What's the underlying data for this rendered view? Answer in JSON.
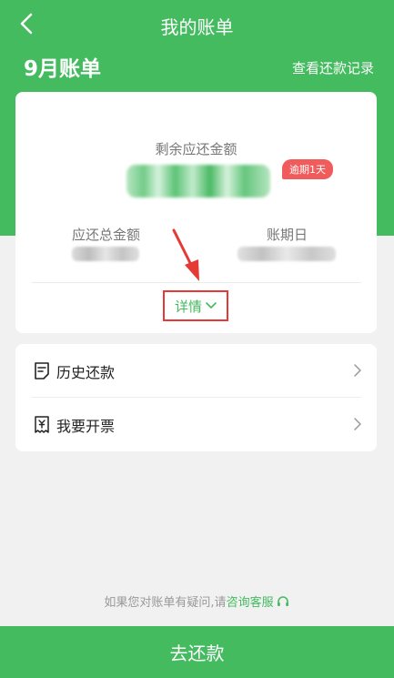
{
  "colors": {
    "brand_green": "#44bb5f",
    "overdue_red": "#f05b5b",
    "highlight_red": "#e53935"
  },
  "nav": {
    "title": "我的账单",
    "back_icon": "chevron-left-icon"
  },
  "header": {
    "month_title": "9月账单",
    "records_link": "查看还款记录"
  },
  "bill": {
    "remaining_label": "剩余应还金额",
    "overdue_badge": "逾期1天",
    "total_label": "应还总金额",
    "date_label": "账期日",
    "detail_label": "详情"
  },
  "menu": [
    {
      "label": "历史还款",
      "icon": "receipt-list-icon"
    },
    {
      "label": "我要开票",
      "icon": "invoice-icon"
    }
  ],
  "help": {
    "prefix": "如果您对账单有疑问,请",
    "link": "咨询客服",
    "icon": "headset-icon"
  },
  "footer": {
    "pay_label": "去还款"
  }
}
